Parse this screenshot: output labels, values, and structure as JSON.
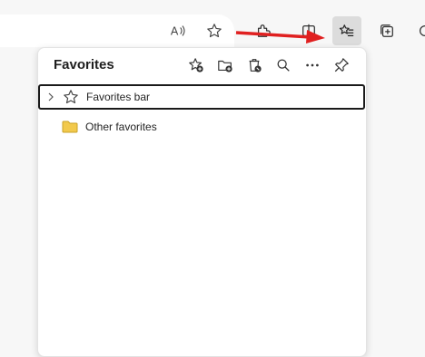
{
  "toolbar": {
    "buttons": [
      {
        "name": "read-aloud-icon",
        "label": "Read aloud"
      },
      {
        "name": "add-favorite-icon",
        "label": "Add this page to favorites"
      },
      {
        "name": "extensions-icon",
        "label": "Extensions"
      },
      {
        "name": "split-screen-icon",
        "label": "Split screen"
      },
      {
        "name": "favorites-icon",
        "label": "Favorites"
      },
      {
        "name": "collections-icon",
        "label": "Collections"
      },
      {
        "name": "copilot-icon",
        "label": "Copilot"
      }
    ],
    "active_button": "favorites-icon",
    "annotation_arrow_color": "#e02020"
  },
  "panel": {
    "title": "Favorites",
    "actions": [
      "add-favorite-icon",
      "add-folder-icon",
      "delete-icon",
      "search-icon",
      "more-icon",
      "pin-icon"
    ],
    "items": [
      {
        "label": "Favorites bar",
        "icon": "star-outline-icon",
        "expandable": true,
        "selected": true
      },
      {
        "label": "Other favorites",
        "icon": "folder-icon",
        "expandable": false,
        "selected": false
      }
    ],
    "folder_color": "#f2c94c"
  }
}
